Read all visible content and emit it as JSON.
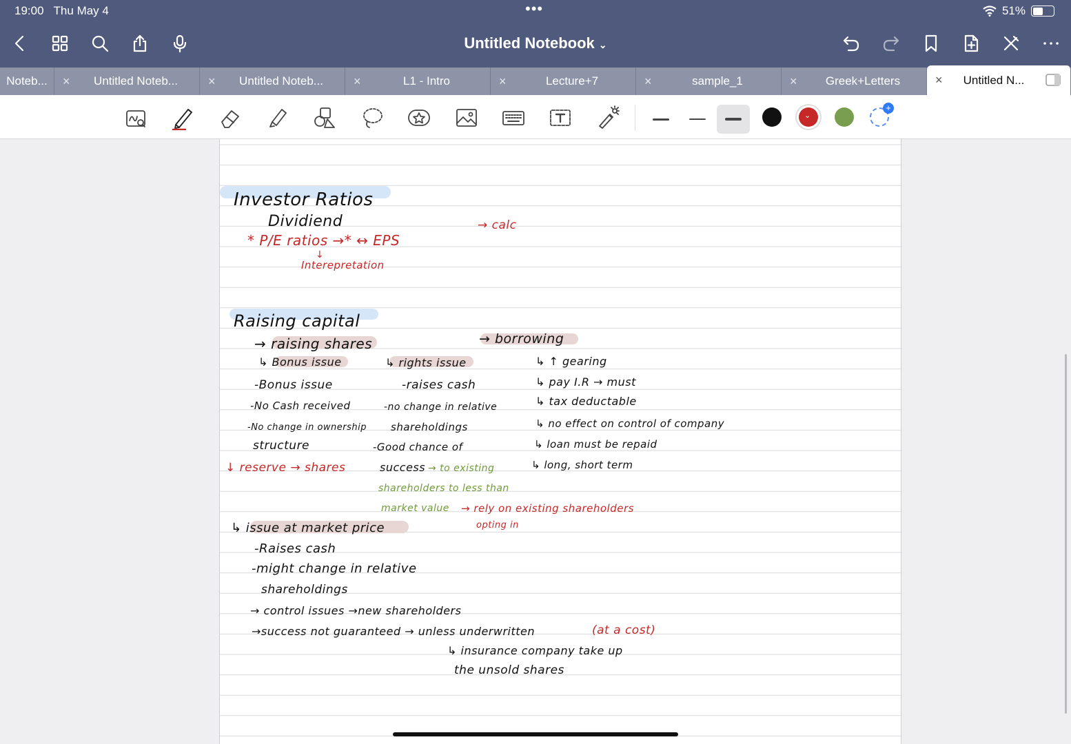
{
  "status_bar": {
    "time": "19:00",
    "date": "Thu May 4",
    "battery": "51%",
    "battery_level": 0.51
  },
  "header": {
    "title": "Untitled Notebook"
  },
  "tabs": [
    {
      "label": "Noteb..."
    },
    {
      "label": "Untitled Noteb..."
    },
    {
      "label": "Untitled Noteb..."
    },
    {
      "label": "L1 - Intro"
    },
    {
      "label": "Lecture+7"
    },
    {
      "label": "sample_1"
    },
    {
      "label": "Greek+Letters"
    },
    {
      "label": "Untitled N...",
      "active": true
    }
  ],
  "tab_close_glyph": "×",
  "colors": {
    "black": "#111111",
    "red": "#c62828",
    "green": "#7a9e4f",
    "topbar": "#4f5a7c"
  },
  "notes": {
    "h1": "Investor Ratios",
    "dividend": "Dividiend",
    "pe": "* P/E ratios →* ↔ EPS",
    "calc": "→ calc",
    "interp_arrow": "↓",
    "interp": "Interepretation",
    "h2": "Raising capital",
    "raising_shares": "→ raising shares",
    "borrowing": "→ borrowing",
    "bonus_head": "↳ Bonus issue",
    "rights_head": "↳ rights issue",
    "gearing": "↳ ↑ gearing",
    "b1": "-Bonus issue",
    "b2": "-No Cash received",
    "b3": "-No change in ownership",
    "b4": "structure",
    "b5": "↓ reserve → shares",
    "r1": "-raises cash",
    "r2": "-no change in relative",
    "r3": "shareholdings",
    "r4": "-Good chance of",
    "r5": "success",
    "r5b": "→ to existing",
    "r6": "shareholders to less than",
    "r7": "market value",
    "r7b": "→ rely on existing shareholders",
    "r8": "opting in",
    "w1": "↳ pay I.R → must",
    "w2": "↳ tax deductable",
    "w3": "↳ no effect on control of company",
    "w4": "↳ loan must be repaid",
    "w5": "↳ long, short term",
    "m1": "↳ issue at market price",
    "m2": "-Raises cash",
    "m3": "-might change in relative",
    "m4": "shareholdings",
    "m5": "→ control issues →new shareholders",
    "m6": "→success not guaranteed → unless underwritten",
    "m6b": "(at a cost)",
    "m7": "↳ insurance company take up",
    "m8": "the unsold shares"
  }
}
